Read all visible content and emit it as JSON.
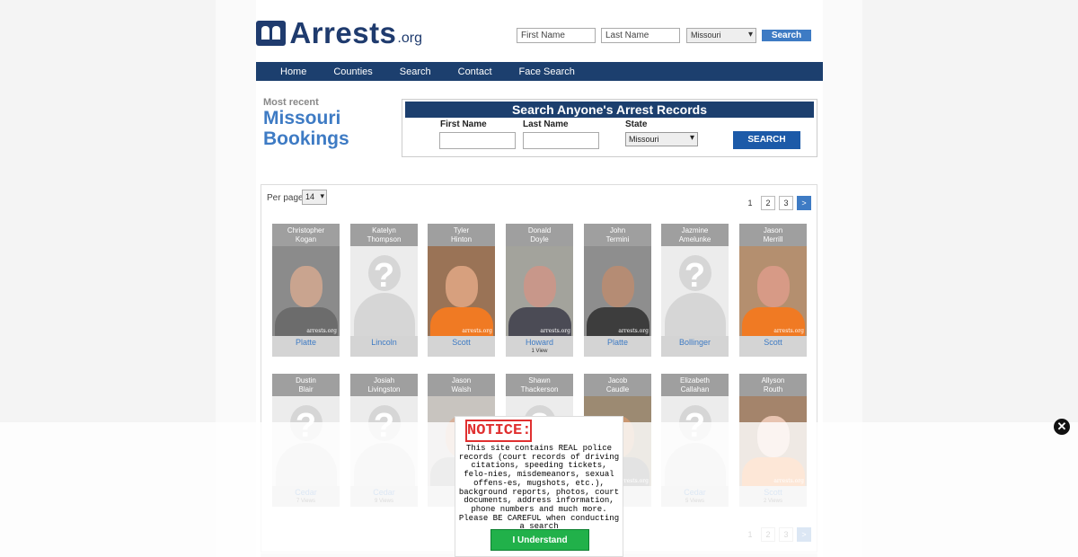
{
  "header": {
    "logo_text": "Arrests",
    "logo_suffix": ".org",
    "first_placeholder": "First Name",
    "last_placeholder": "Last Name",
    "state": "Missouri",
    "search_label": "Search"
  },
  "nav": {
    "items": [
      "Home",
      "Counties",
      "Search",
      "Contact",
      "Face Search"
    ]
  },
  "headline": {
    "most_recent": "Most recent",
    "line1": "Missouri",
    "line2": "Bookings"
  },
  "search_box": {
    "title": "Search Anyone's Arrest Records",
    "first_label": "First Name",
    "last_label": "Last Name",
    "state_label": "State",
    "state_value": "Missouri",
    "button": "SEARCH"
  },
  "listing": {
    "per_page_label": "Per page",
    "per_page": "14",
    "pages": [
      "1",
      "2",
      "3",
      ">"
    ]
  },
  "cards": [
    {
      "first": "Christopher",
      "last": "Kogan",
      "county": "Platte",
      "views": "",
      "photo": "mug",
      "skin": "#c9a48f",
      "bg": "#8b8b8b",
      "shirt": "#6c6c6c"
    },
    {
      "first": "Katelyn",
      "last": "Thompson",
      "county": "Lincoln",
      "views": "",
      "photo": "unknown"
    },
    {
      "first": "Tyler",
      "last": "Hinton",
      "county": "Scott",
      "views": "",
      "photo": "mug",
      "skin": "#d7a07e",
      "bg": "#9a7356",
      "shirt": "#f07a23"
    },
    {
      "first": "Donald",
      "last": "Doyle",
      "county": "Howard",
      "views": "1 View",
      "photo": "mug",
      "skin": "#c8978a",
      "bg": "#a3a39c",
      "shirt": "#4b4b55"
    },
    {
      "first": "John",
      "last": "Termini",
      "county": "Platte",
      "views": "",
      "photo": "mug",
      "skin": "#b58c74",
      "bg": "#8e8e8e",
      "shirt": "#3d3d3d"
    },
    {
      "first": "Jazmine",
      "last": "Amelunke",
      "county": "Bollinger",
      "views": "",
      "photo": "unknown"
    },
    {
      "first": "Jason",
      "last": "Merrill",
      "county": "Scott",
      "views": "",
      "photo": "mug",
      "skin": "#d79a86",
      "bg": "#b48f6f",
      "shirt": "#f07a23"
    },
    {
      "first": "Dustin",
      "last": "Blair",
      "county": "Cedar",
      "views": "7 Views",
      "photo": "unknown"
    },
    {
      "first": "Josiah",
      "last": "Livingston",
      "county": "Cedar",
      "views": "9 Views",
      "photo": "unknown"
    },
    {
      "first": "Jason",
      "last": "Walsh",
      "county": "",
      "views": "",
      "photo": "mug",
      "skin": "#d8b09a",
      "bg": "#c8c4bf",
      "shirt": "#9a9a9a"
    },
    {
      "first": "Shawn",
      "last": "Thackerson",
      "county": "",
      "views": "",
      "photo": "unknown"
    },
    {
      "first": "Jacob",
      "last": "Caudle",
      "county": "",
      "views": "",
      "photo": "mug",
      "skin": "#c99670",
      "bg": "#9c8a72",
      "shirt": "#666"
    },
    {
      "first": "Elizabeth",
      "last": "Callahan",
      "county": "Cedar",
      "views": "5 Views",
      "photo": "unknown"
    },
    {
      "first": "Allyson",
      "last": "Routh",
      "county": "Scott",
      "views": "2 Views",
      "photo": "mug",
      "skin": "#e8c4b1",
      "bg": "#a4846b",
      "shirt": "#f07a23"
    }
  ],
  "watermark": "arrests.org",
  "notice": {
    "title": "NOTICE:",
    "text": "This site contains REAL police records (court records of driving citations, speeding tickets, felo-nies, misdemeanors, sexual offens-es, mugshots, etc.), background reports, photos, court documents, address information, phone numbers and much more. Please BE CAREFUL when conducting a search",
    "button": "I Understand"
  }
}
